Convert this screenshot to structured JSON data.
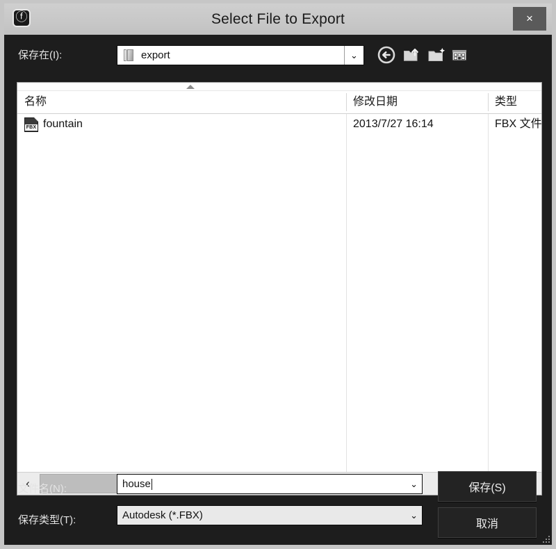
{
  "window": {
    "title": "Select File to Export",
    "app_icon": "max-logo-icon",
    "close_label": "×"
  },
  "toolbar": {
    "lookin_label": "保存在(I):",
    "lookin_value": "export",
    "lookin_dropdown_glyph": "⌄",
    "buttons": [
      {
        "name": "back-button",
        "tooltip": "返回"
      },
      {
        "name": "up-one-level-button",
        "tooltip": "上一级"
      },
      {
        "name": "new-folder-button",
        "tooltip": "新建文件夹"
      },
      {
        "name": "view-mode-button",
        "tooltip": "视图"
      }
    ]
  },
  "file_list": {
    "columns": [
      {
        "key": "name",
        "label": "名称"
      },
      {
        "key": "date",
        "label": "修改日期"
      },
      {
        "key": "type",
        "label": "类型"
      }
    ],
    "sort_column": "name",
    "sort_direction": "ascending",
    "rows": [
      {
        "icon": "fbx-file-icon",
        "icon_label": "FBX",
        "name": "fountain",
        "date": "2013/7/27 16:14",
        "type": "FBX 文件"
      }
    ]
  },
  "scrollbar": {
    "left_glyph": "‹",
    "right_glyph": "›",
    "thumb_fraction": 0.72
  },
  "form": {
    "filename_label": "文件名(N):",
    "filename_value": "house",
    "filetype_label": "保存类型(T):",
    "filetype_value": "Autodesk (*.FBX)",
    "dropdown_glyph": "⌄"
  },
  "actions": {
    "save_label": "保存(S)",
    "cancel_label": "取消"
  },
  "colors": {
    "titlebar": "#c8c8c8",
    "dialog_bg": "#1d1d1d",
    "list_bg": "#ffffff",
    "text_light": "#e3e3e3",
    "text_dark": "#111111",
    "close_button": "#5a5a5a"
  }
}
